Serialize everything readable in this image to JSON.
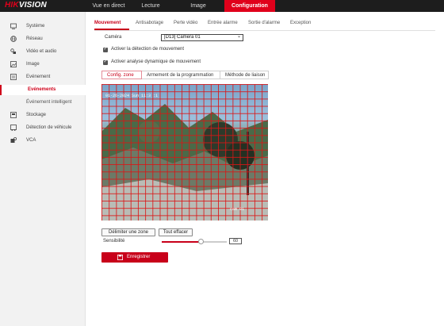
{
  "app": {
    "logo_brand": "HIK",
    "logo_rest": "VISION"
  },
  "topnav": [
    {
      "label": "Vue en direct",
      "active": false
    },
    {
      "label": "Lecture",
      "active": false
    },
    {
      "label": "Image",
      "active": false
    },
    {
      "label": "Configuration",
      "active": true
    }
  ],
  "sidebar": {
    "items": [
      {
        "label": "Système",
        "icon": "monitor-icon"
      },
      {
        "label": "Réseau",
        "icon": "globe-icon"
      },
      {
        "label": "Vidéo et audio",
        "icon": "video-audio-icon"
      },
      {
        "label": "Image",
        "icon": "image-icon"
      },
      {
        "label": "Evénement",
        "icon": "event-icon"
      }
    ],
    "sub_items": [
      {
        "label": "Evénements",
        "active": true
      },
      {
        "label": "Événement intelligent",
        "active": false
      }
    ],
    "items_after": [
      {
        "label": "Stockage",
        "icon": "storage-icon"
      },
      {
        "label": "Détection de véhicule",
        "icon": "vehicle-icon"
      },
      {
        "label": "VCA",
        "icon": "vca-icon"
      }
    ]
  },
  "tabs": [
    {
      "label": "Mouvement",
      "active": true
    },
    {
      "label": "Antisabotage",
      "active": false
    },
    {
      "label": "Perte vidéo",
      "active": false
    },
    {
      "label": "Entrée alarme",
      "active": false
    },
    {
      "label": "Sortie d'alarme",
      "active": false
    },
    {
      "label": "Exception",
      "active": false
    }
  ],
  "form": {
    "camera_label": "Caméra",
    "camera_value": "[D13] Camera 01",
    "enable_motion_label": "Activer la détection de mouvement",
    "enable_motion_checked": true,
    "dynamic_analysis_label": "Activer analyse dynamique de mouvement",
    "dynamic_analysis_checked": true
  },
  "steps": [
    {
      "label": "Config. zone",
      "active": true
    },
    {
      "label": "Armement de la programmation",
      "active": false
    },
    {
      "label": "Méthode de liaison",
      "active": false
    }
  ],
  "video": {
    "timestamp": "01-26-2024 Sun 11:3 :1",
    "camera_overlay": "cam 01"
  },
  "controls": {
    "draw_area_label": "Délimiter une zone",
    "clear_all_label": "Tout effacer",
    "sensitivity_label": "Sensibilité",
    "sensitivity_value": "60",
    "sensitivity_fraction": 0.6,
    "save_label": "Enregistrer"
  },
  "colors": {
    "accent": "#c8001a",
    "topbar": "#1d1d1d",
    "grid": "#dc1414"
  }
}
